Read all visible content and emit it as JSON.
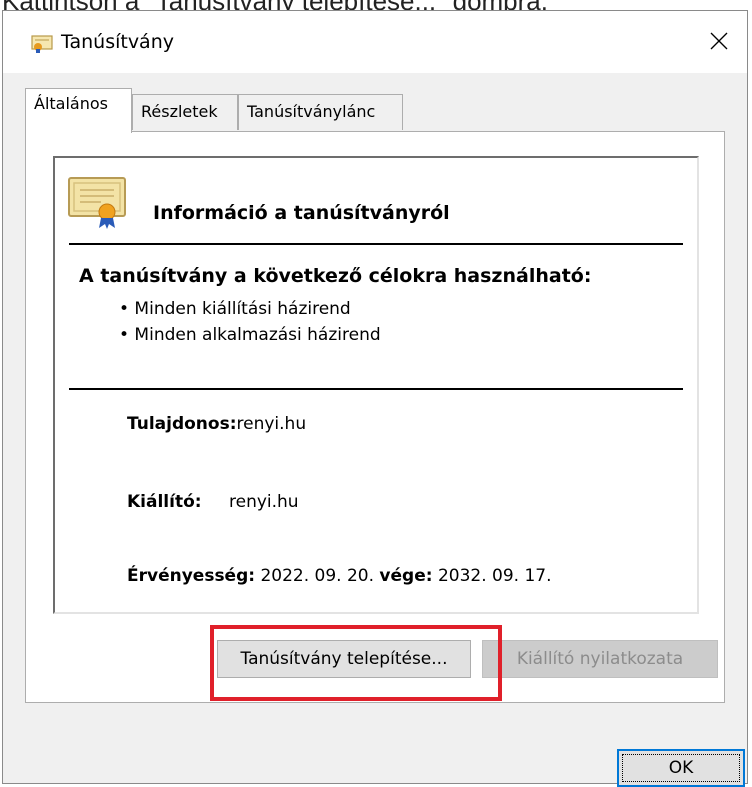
{
  "caption": "Kattintson a \"Tanúsítvány telepítése...\" gombra.",
  "window": {
    "title": "Tanúsítvány"
  },
  "tabs": [
    {
      "label": "Általános",
      "active": true
    },
    {
      "label": "Részletek",
      "active": false
    },
    {
      "label": "Tanúsítványlánc",
      "active": false
    }
  ],
  "info": {
    "title": "Információ a tanúsítványról",
    "purpose_title": "A tanúsítvány a következő célokra használható:",
    "purposes": [
      "• Minden kiállítási házirend",
      "• Minden alkalmazási házirend"
    ]
  },
  "fields": {
    "owner_label": "Tulajdonos:",
    "owner_value": "renyi.hu",
    "issuer_label": "Kiállító:",
    "issuer_value": "renyi.hu",
    "validity_label": "Érvényesség:",
    "validity_from": "2022. 09. 20.",
    "validity_to_label": "vége:",
    "validity_to": "2032. 09. 17."
  },
  "buttons": {
    "install": "Tanúsítvány telepítése...",
    "issuer_statement": "Kiállító nyilatkozata",
    "ok": "OK"
  },
  "colors": {
    "highlight": "#e0202a",
    "focus": "#0078d7"
  },
  "icons": [
    "certificate-icon",
    "close-icon",
    "certificate-large-icon"
  ]
}
